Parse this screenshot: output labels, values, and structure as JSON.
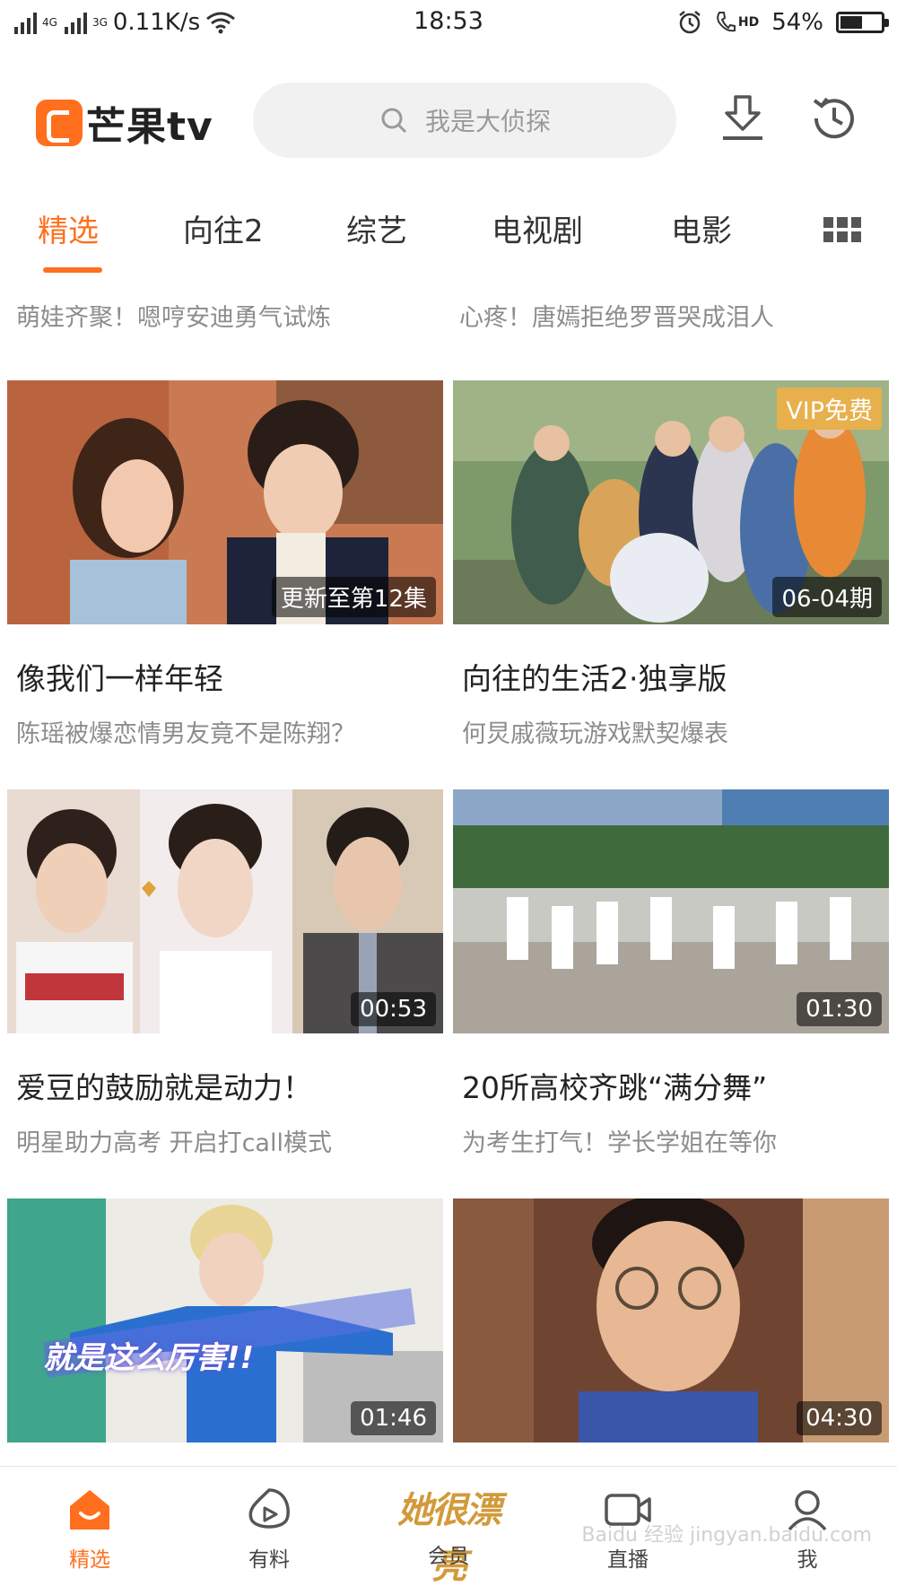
{
  "status_bar": {
    "network_1": "4G",
    "network_2": "3G",
    "speed": "0.11K/s",
    "time": "18:53",
    "hd_label": "HD",
    "battery_percent": "54%",
    "battery_level": 0.54
  },
  "header": {
    "logo_text": "芒果tv",
    "search_placeholder": "我是大侦探"
  },
  "tabs": [
    "精选",
    "向往2",
    "综艺",
    "电视剧",
    "电影"
  ],
  "partial_row": {
    "left_subtitle": "萌娃齐聚！嗯哼安迪勇气试炼",
    "right_subtitle": "心疼！唐嫣拒绝罗晋哭成泪人"
  },
  "cards": [
    {
      "title": "像我们一样年轻",
      "subtitle": "陈瑶被爆恋情男友竟不是陈翔？",
      "badge": "更新至第12集",
      "vip": ""
    },
    {
      "title": "向往的生活2·独享版",
      "subtitle": "何炅戚薇玩游戏默契爆表",
      "badge": "06-04期",
      "vip": "VIP免费"
    },
    {
      "title": "爱豆的鼓励就是动力！",
      "subtitle": "明星助力高考 开启打call模式",
      "badge": "00:53",
      "vip": ""
    },
    {
      "title": "20所高校齐跳“满分舞”",
      "subtitle": "为考生打气！学长学姐在等你",
      "badge": "01:30",
      "vip": ""
    },
    {
      "title": "",
      "subtitle": "",
      "badge": "01:46",
      "vip": "",
      "overlay_text": "就是这么厉害!!"
    },
    {
      "title": "",
      "subtitle": "",
      "badge": "04:30",
      "vip": ""
    }
  ],
  "bottom_nav": {
    "items": [
      "精选",
      "有料",
      "会员",
      "直播",
      "我"
    ],
    "vip_label": "她很漂亮",
    "watermark": "Baidu 经验 jingyan.baidu.com"
  },
  "colors": {
    "accent": "#ff6f1e",
    "vip_gold": "#e7b04c"
  },
  "icons": [
    "search-icon",
    "download-icon",
    "history-icon",
    "grid-menu-icon",
    "home-icon",
    "discover-icon",
    "live-camera-icon",
    "profile-icon"
  ]
}
